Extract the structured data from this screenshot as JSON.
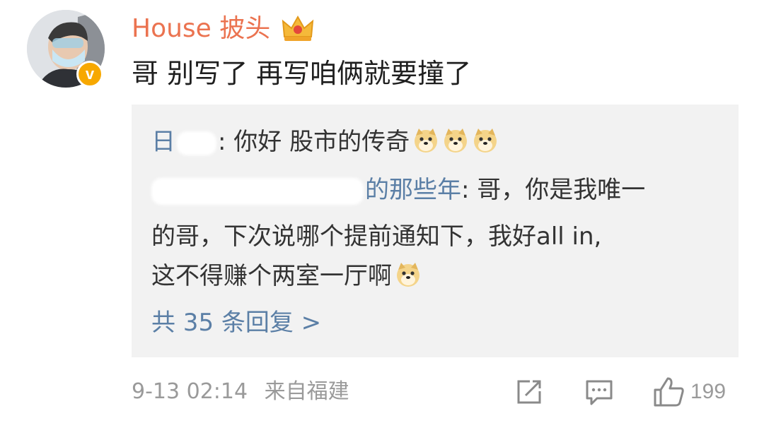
{
  "comment": {
    "username": "House 披头",
    "badge_icon": "crown-icon",
    "verified_icon": "verified-v-icon",
    "verified_letter": "v",
    "text": "哥 别写了 再写咱俩就要撞了",
    "accent_color": "#eb7350"
  },
  "replies": {
    "reply1": {
      "name_visible": "日",
      "name_suffix": ":",
      "text": " 你好 股市的传奇",
      "emoji_count": 3
    },
    "reply2": {
      "name_visible": "的那些年",
      "line1_text": ": 哥，你是我唯一",
      "line2_text": "的哥，下次说哪个提前通知下，我好all in,",
      "line3_text": "这不得赚个两室一厅啊",
      "emoji_count": 1
    },
    "more_label": "共 35 条回复 >",
    "link_color": "#5b7fa6"
  },
  "footer": {
    "time": "9-13 02:14",
    "source": "来自福建",
    "like_count": "199"
  }
}
